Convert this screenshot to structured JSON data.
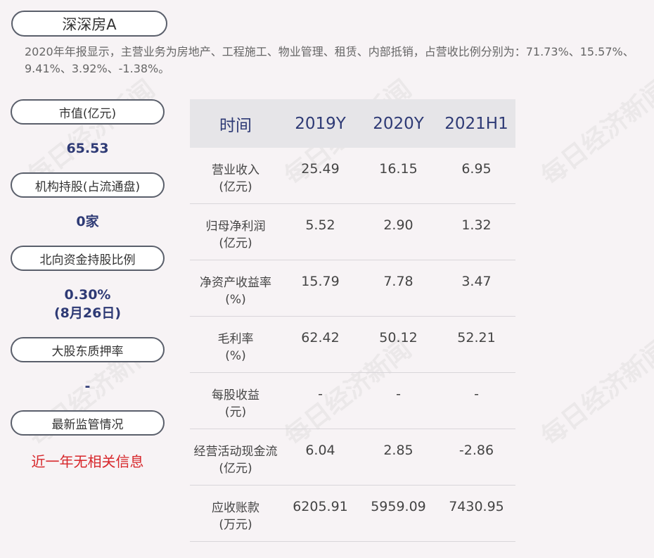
{
  "stock_name": "深深房A",
  "summary": "2020年年报显示，主营业务为房地产、工程施工、物业管理、租赁、内部抵销，占营收比例分别为：71.73%、15.57%、9.41%、3.92%、-1.38%。",
  "left_panel": {
    "market_cap_label": "市值(亿元)",
    "market_cap_value": "65.53",
    "institution_label": "机构持股(占流通盘)",
    "institution_value": "0家",
    "northbound_label": "北向资金持股比例",
    "northbound_value": "0.30%",
    "northbound_date": "(8月26日)",
    "pledge_label": "大股东质押率",
    "pledge_value": "-",
    "regulatory_label": "最新监管情况",
    "regulatory_value": "近一年无相关信息"
  },
  "table": {
    "headers": [
      "时间",
      "2019Y",
      "2020Y",
      "2021H1"
    ],
    "rows": [
      {
        "label": "营业收入",
        "unit": "(亿元)",
        "values": [
          "25.49",
          "16.15",
          "6.95"
        ]
      },
      {
        "label": "归母净利润",
        "unit": "(亿元)",
        "values": [
          "5.52",
          "2.90",
          "1.32"
        ]
      },
      {
        "label": "净资产收益率",
        "unit": "(%)",
        "values": [
          "15.79",
          "7.78",
          "3.47"
        ]
      },
      {
        "label": "毛利率",
        "unit": "(%)",
        "values": [
          "62.42",
          "50.12",
          "52.21"
        ]
      },
      {
        "label": "每股收益",
        "unit": "(元)",
        "values": [
          "-",
          "-",
          "-"
        ]
      },
      {
        "label": "经营活动现金流",
        "unit": "(亿元)",
        "values": [
          "6.04",
          "2.85",
          "-2.86"
        ]
      },
      {
        "label": "应收账款",
        "unit": "(万元)",
        "values": [
          "6205.91",
          "5959.09",
          "7430.95"
        ]
      }
    ]
  },
  "watermark": "每日经济新闻"
}
